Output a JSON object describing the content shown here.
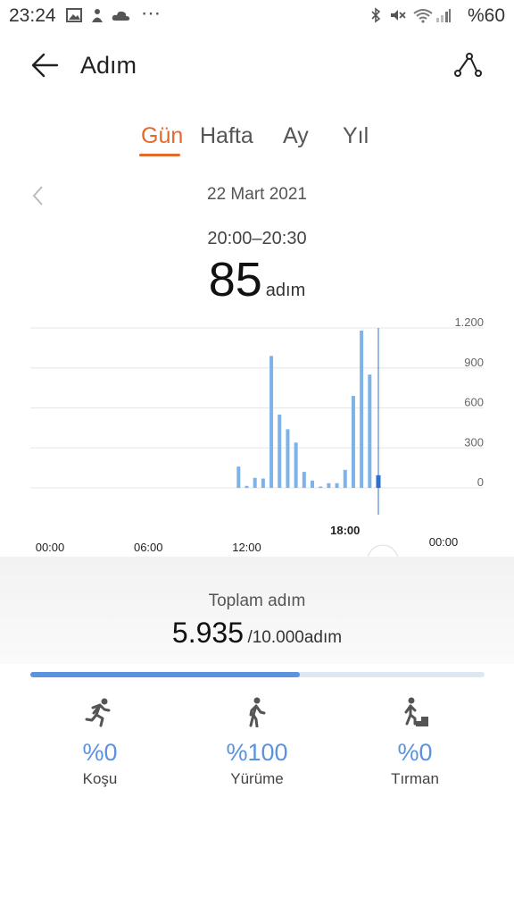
{
  "status_bar": {
    "time": "23:24",
    "battery": "%60",
    "left_icons": [
      "image-icon",
      "person-icon",
      "cloud-icon",
      "more-icon"
    ],
    "right_icons": [
      "bluetooth-icon",
      "mute-icon",
      "wifi-icon",
      "signal-icon"
    ]
  },
  "header": {
    "title": "Adım",
    "back_icon": "back-arrow-icon",
    "share_icon": "route-icon"
  },
  "tabs": [
    {
      "label": "Gün",
      "active": true
    },
    {
      "label": "Hafta",
      "active": false
    },
    {
      "label": "Ay",
      "active": false
    },
    {
      "label": "Yıl",
      "active": false
    }
  ],
  "date": "22 Mart 2021",
  "selected": {
    "range": "20:00–20:30",
    "steps": "85",
    "unit": "adım"
  },
  "chart_data": {
    "type": "bar",
    "ylim": [
      0,
      1200
    ],
    "yticks": [
      "1.200",
      "900",
      "600",
      "300",
      "0"
    ],
    "xticks": [
      "00:00",
      "06:00",
      "12:00",
      "18:00",
      "00:00"
    ],
    "x_hours": [
      11.5,
      12.0,
      12.5,
      13.0,
      13.5,
      14.0,
      14.5,
      15.0,
      15.5,
      16.0,
      16.5,
      17.0,
      17.5,
      18.0,
      18.5,
      19.0,
      19.5,
      20.0
    ],
    "values": [
      160,
      15,
      75,
      70,
      990,
      550,
      440,
      340,
      120,
      55,
      5,
      35,
      35,
      135,
      690,
      1180,
      850,
      95
    ],
    "selected_bar": {
      "x_hour": 20.0,
      "value": 85
    },
    "colors": {
      "bar": "#7db3e8",
      "selected": "#2f6fcf",
      "grid": "#e6e6e6"
    }
  },
  "summary": {
    "total_label": "Toplam adım",
    "total_value": "5.935",
    "goal": "/10.000adım",
    "progress": 0.5935
  },
  "activities": [
    {
      "name": "run-icon",
      "percent": "%0",
      "label": "Koşu"
    },
    {
      "name": "walk-icon",
      "percent": "%100",
      "label": "Yürüme"
    },
    {
      "name": "climb-icon",
      "percent": "%0",
      "label": "Tırman"
    }
  ]
}
